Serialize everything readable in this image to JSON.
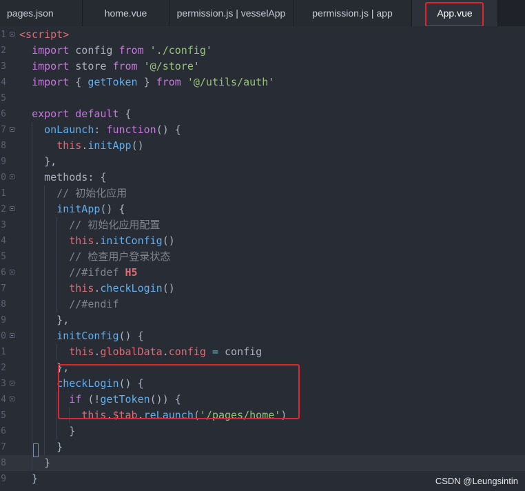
{
  "tabs": [
    {
      "label": "pages.json",
      "active": false
    },
    {
      "label": "home.vue",
      "active": false
    },
    {
      "label": "permission.js | vesselApp",
      "active": false
    },
    {
      "label": "permission.js | app",
      "active": false
    },
    {
      "label": "App.vue",
      "active": true
    }
  ],
  "editor": {
    "current_line": 28,
    "lines": [
      {
        "n": "1",
        "fold": true,
        "tokens": [
          {
            "t": "<script>",
            "c": "tag"
          }
        ]
      },
      {
        "n": "2",
        "fold": false,
        "tokens": [
          {
            "t": "  "
          },
          {
            "t": "import",
            "c": "kw"
          },
          {
            "t": " config "
          },
          {
            "t": "from",
            "c": "kw"
          },
          {
            "t": " "
          },
          {
            "t": "'./config'",
            "c": "str"
          }
        ]
      },
      {
        "n": "3",
        "fold": false,
        "tokens": [
          {
            "t": "  "
          },
          {
            "t": "import",
            "c": "kw"
          },
          {
            "t": " store "
          },
          {
            "t": "from",
            "c": "kw"
          },
          {
            "t": " "
          },
          {
            "t": "'@/store'",
            "c": "str"
          }
        ]
      },
      {
        "n": "4",
        "fold": false,
        "tokens": [
          {
            "t": "  "
          },
          {
            "t": "import",
            "c": "kw"
          },
          {
            "t": " { "
          },
          {
            "t": "getToken",
            "c": "fn"
          },
          {
            "t": " } "
          },
          {
            "t": "from",
            "c": "kw"
          },
          {
            "t": " "
          },
          {
            "t": "'@/utils/auth'",
            "c": "str"
          }
        ]
      },
      {
        "n": "5",
        "fold": false,
        "tokens": []
      },
      {
        "n": "6",
        "fold": false,
        "tokens": [
          {
            "t": "  "
          },
          {
            "t": "export",
            "c": "kw"
          },
          {
            "t": " "
          },
          {
            "t": "default",
            "c": "kw"
          },
          {
            "t": " {"
          }
        ]
      },
      {
        "n": "7",
        "fold": true,
        "tokens": [
          {
            "t": "    "
          },
          {
            "t": "onLaunch",
            "c": "fn"
          },
          {
            "t": ": "
          },
          {
            "t": "function",
            "c": "kw"
          },
          {
            "t": "() {"
          }
        ]
      },
      {
        "n": "8",
        "fold": false,
        "tokens": [
          {
            "t": "      "
          },
          {
            "t": "this",
            "c": "prop"
          },
          {
            "t": "."
          },
          {
            "t": "initApp",
            "c": "fn"
          },
          {
            "t": "()"
          }
        ]
      },
      {
        "n": "9",
        "fold": false,
        "tokens": [
          {
            "t": "    },"
          }
        ]
      },
      {
        "n": "0",
        "fold": true,
        "tokens": [
          {
            "t": "    methods: {"
          }
        ]
      },
      {
        "n": "1",
        "fold": false,
        "tokens": [
          {
            "t": "      "
          },
          {
            "t": "// 初始化应用",
            "c": "cmt"
          }
        ]
      },
      {
        "n": "2",
        "fold": true,
        "tokens": [
          {
            "t": "      "
          },
          {
            "t": "initApp",
            "c": "fn"
          },
          {
            "t": "() {"
          }
        ]
      },
      {
        "n": "3",
        "fold": false,
        "tokens": [
          {
            "t": "        "
          },
          {
            "t": "// 初始化应用配置",
            "c": "cmt"
          }
        ]
      },
      {
        "n": "4",
        "fold": false,
        "tokens": [
          {
            "t": "        "
          },
          {
            "t": "this",
            "c": "prop"
          },
          {
            "t": "."
          },
          {
            "t": "initConfig",
            "c": "fn"
          },
          {
            "t": "()"
          }
        ]
      },
      {
        "n": "5",
        "fold": false,
        "tokens": [
          {
            "t": "        "
          },
          {
            "t": "// 检查用户登录状态",
            "c": "cmt"
          }
        ]
      },
      {
        "n": "6",
        "fold": true,
        "tokens": [
          {
            "t": "        "
          },
          {
            "t": "//#ifdef ",
            "c": "cmt"
          },
          {
            "t": "H5",
            "c": "pre"
          }
        ]
      },
      {
        "n": "7",
        "fold": false,
        "tokens": [
          {
            "t": "        "
          },
          {
            "t": "this",
            "c": "prop"
          },
          {
            "t": "."
          },
          {
            "t": "checkLogin",
            "c": "fn"
          },
          {
            "t": "()"
          }
        ]
      },
      {
        "n": "8",
        "fold": false,
        "tokens": [
          {
            "t": "        "
          },
          {
            "t": "//#endif",
            "c": "cmt"
          }
        ]
      },
      {
        "n": "9",
        "fold": false,
        "tokens": [
          {
            "t": "      },"
          }
        ]
      },
      {
        "n": "0",
        "fold": true,
        "tokens": [
          {
            "t": "      "
          },
          {
            "t": "initConfig",
            "c": "fn"
          },
          {
            "t": "() {"
          }
        ]
      },
      {
        "n": "1",
        "fold": false,
        "tokens": [
          {
            "t": "        "
          },
          {
            "t": "this",
            "c": "prop"
          },
          {
            "t": "."
          },
          {
            "t": "globalData",
            "c": "prop"
          },
          {
            "t": "."
          },
          {
            "t": "config",
            "c": "prop"
          },
          {
            "t": " "
          },
          {
            "t": "=",
            "c": "op"
          },
          {
            "t": " config"
          }
        ]
      },
      {
        "n": "2",
        "fold": false,
        "tokens": [
          {
            "t": "      },"
          }
        ]
      },
      {
        "n": "3",
        "fold": true,
        "tokens": [
          {
            "t": "      "
          },
          {
            "t": "checkLogin",
            "c": "fn"
          },
          {
            "t": "() {"
          }
        ]
      },
      {
        "n": "4",
        "fold": true,
        "tokens": [
          {
            "t": "        "
          },
          {
            "t": "if",
            "c": "kw"
          },
          {
            "t": " (!"
          },
          {
            "t": "getToken",
            "c": "fn"
          },
          {
            "t": "()) {"
          }
        ]
      },
      {
        "n": "5",
        "fold": false,
        "tokens": [
          {
            "t": "          "
          },
          {
            "t": "this",
            "c": "prop"
          },
          {
            "t": "."
          },
          {
            "t": "$tab",
            "c": "prop"
          },
          {
            "t": "."
          },
          {
            "t": "reLaunch",
            "c": "fn"
          },
          {
            "t": "("
          },
          {
            "t": "'/pages/home'",
            "c": "str"
          },
          {
            "t": ")"
          }
        ]
      },
      {
        "n": "6",
        "fold": false,
        "tokens": [
          {
            "t": "        }"
          }
        ]
      },
      {
        "n": "7",
        "fold": false,
        "tokens": [
          {
            "t": "      }"
          }
        ]
      },
      {
        "n": "8",
        "fold": false,
        "tokens": [
          {
            "t": "    }"
          }
        ]
      },
      {
        "n": "9",
        "fold": false,
        "tokens": [
          {
            "t": "  }"
          }
        ]
      }
    ]
  },
  "watermark": "CSDN @Leungsintin",
  "colors": {
    "highlight_box": "#e0252d",
    "editor_bg": "#282c34"
  }
}
